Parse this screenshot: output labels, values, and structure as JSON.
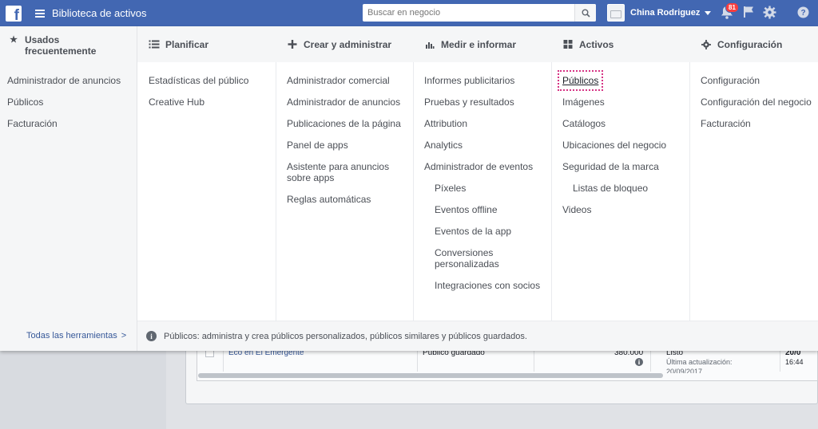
{
  "topbar": {
    "app_title": "Biblioteca de activos",
    "search_placeholder": "Buscar en negocio",
    "user_name": "China Rodriguez",
    "notification_count": "81",
    "brand_color": "#4267b2"
  },
  "menu": {
    "frequent": {
      "title": "Usados frecuentemente",
      "items": [
        "Administrador de anuncios",
        "Públicos",
        "Facturación"
      ],
      "all_tools": "Todas las herramientas"
    },
    "plan": {
      "title": "Planificar",
      "items": [
        "Estadísticas del público",
        "Creative Hub"
      ]
    },
    "create": {
      "title": "Crear y administrar",
      "items": [
        "Administrador comercial",
        "Administrador de anuncios",
        "Publicaciones de la página",
        "Panel de apps",
        "Asistente para anuncios sobre apps",
        "Reglas automáticas"
      ]
    },
    "measure": {
      "title": "Medir e informar",
      "items": [
        "Informes publicitarios",
        "Pruebas y resultados",
        "Attribution",
        "Analytics",
        "Administrador de eventos"
      ],
      "sub_items": [
        "Píxeles",
        "Eventos offline",
        "Eventos de la app",
        "Conversiones personalizadas",
        "Integraciones con socios"
      ]
    },
    "assets": {
      "title": "Activos",
      "items": [
        "Públicos",
        "Imágenes",
        "Catálogos",
        "Ubicaciones del negocio",
        "Seguridad de la marca"
      ],
      "sub_items": [
        "Listas de bloqueo"
      ],
      "last_item": "Videos"
    },
    "settings": {
      "title": "Configuración",
      "items": [
        "Configuración",
        "Configuración del negocio",
        "Facturación"
      ]
    },
    "footer_text": "Públicos: administra y crea públicos personalizados, públicos similares y públicos guardados."
  },
  "background": {
    "row_name": "Eco en El Emergente",
    "row_type": "Público guardado",
    "row_size": "380.000",
    "row_status": "Listo",
    "row_updated_label": "Última actualización:",
    "row_updated_date": "20/09/2017",
    "row_date_partial": "20/0",
    "row_time_partial": "16:44"
  }
}
